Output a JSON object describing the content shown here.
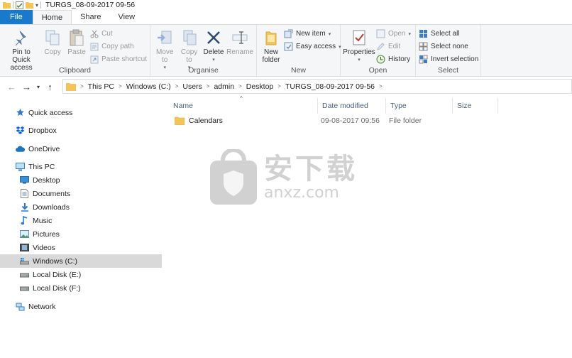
{
  "window": {
    "title": "TURGS_08-09-2017 09-56"
  },
  "tabs": [
    {
      "label": "File"
    },
    {
      "label": "Home"
    },
    {
      "label": "Share"
    },
    {
      "label": "View"
    }
  ],
  "ribbon": {
    "clipboard": {
      "label": "Clipboard",
      "pin": "Pin to Quick access",
      "copy": "Copy",
      "paste": "Paste",
      "cut": "Cut",
      "copy_path": "Copy path",
      "paste_shortcut": "Paste shortcut"
    },
    "organise": {
      "label": "Organise",
      "move_to": "Move to",
      "copy_to": "Copy to",
      "delete": "Delete",
      "rename": "Rename"
    },
    "new": {
      "label": "New",
      "new_folder": "New folder",
      "new_item": "New item",
      "easy_access": "Easy access"
    },
    "open": {
      "label": "Open",
      "properties": "Properties",
      "open": "Open",
      "edit": "Edit",
      "history": "History"
    },
    "select": {
      "label": "Select",
      "select_all": "Select all",
      "select_none": "Select none",
      "invert_selection": "Invert selection"
    }
  },
  "address": {
    "crumbs": [
      "This PC",
      "Windows (C:)",
      "Users",
      "admin",
      "Desktop",
      "TURGS_08-09-2017 09-56"
    ]
  },
  "nav": {
    "quick_access": "Quick access",
    "dropbox": "Dropbox",
    "onedrive": "OneDrive",
    "this_pc": "This PC",
    "desktop": "Desktop",
    "documents": "Documents",
    "downloads": "Downloads",
    "music": "Music",
    "pictures": "Pictures",
    "videos": "Videos",
    "windows_c": "Windows (C:)",
    "local_e": "Local Disk (E:)",
    "local_f": "Local Disk (F:)",
    "network": "Network"
  },
  "columns": {
    "name": "Name",
    "date": "Date modified",
    "type": "Type",
    "size": "Size"
  },
  "files": [
    {
      "name": "Calendars",
      "date": "09-08-2017 09:56",
      "type": "File folder",
      "size": ""
    }
  ],
  "watermark": {
    "cn": "安下载",
    "en": "anxz.com"
  },
  "colors": {
    "accent": "#1979ca",
    "folder": "#f4c455",
    "selected": "#d9d9d9"
  }
}
